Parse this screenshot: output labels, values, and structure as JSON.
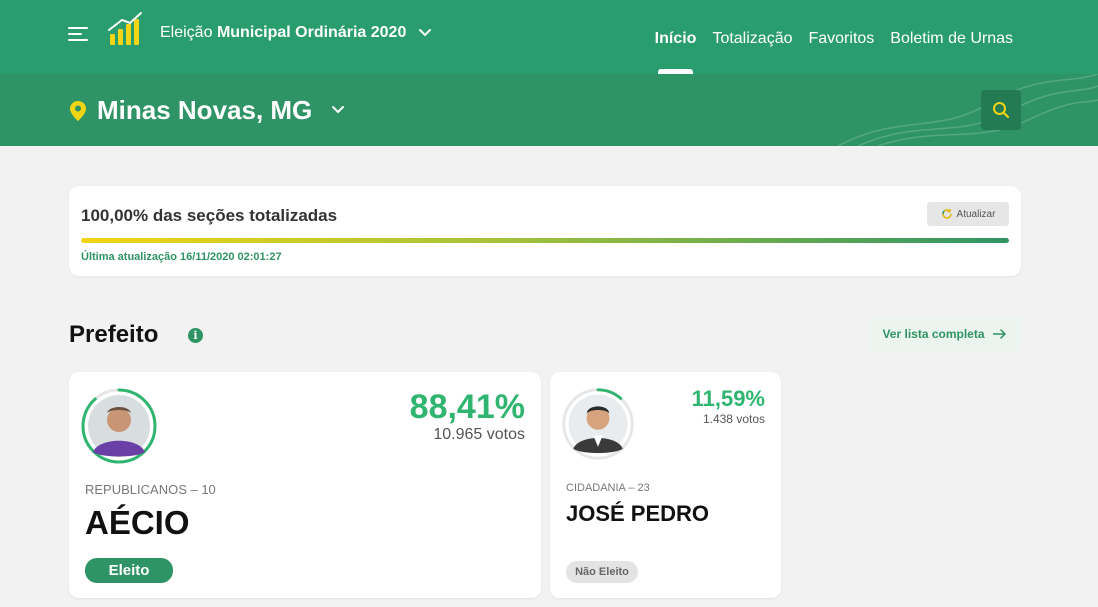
{
  "header": {
    "election_prefix": "Eleição",
    "election_bold": "Municipal Ordinária 2020",
    "nav": [
      "Início",
      "Totalização",
      "Favoritos",
      "Boletim de Urnas"
    ],
    "active_nav": "Início"
  },
  "location": {
    "name": "Minas Novas, MG"
  },
  "progress": {
    "title": "100,00% das seções totalizadas",
    "fraction": 1.0,
    "refresh_label": "Atualizar",
    "updated": "Última atualização 16/11/2020 02:01:27"
  },
  "section": {
    "title": "Prefeito",
    "list_button": "Ver lista completa"
  },
  "candidates": [
    {
      "name": "AÉCIO",
      "party": "REPUBLICANOS – 10",
      "percent": "88,41%",
      "vote_share": 0.8841,
      "votes": "10.965 votos",
      "status": "Eleito"
    },
    {
      "name": "JOSÉ PEDRO",
      "party": "CIDADANIA – 23",
      "percent": "11,59%",
      "vote_share": 0.1159,
      "votes": "1.438 votos",
      "status": "Não Eleito"
    }
  ],
  "colors": {
    "primary": "#2a9d6f",
    "secondary": "#2f9465",
    "accent": "#f2d514",
    "percent": "#2fb56f"
  },
  "icons": {
    "menu": "hamburger-icon",
    "logo": "bar-chart-logo",
    "location": "map-pin-icon",
    "search": "search-icon",
    "refresh": "refresh-icon",
    "info": "info-icon",
    "arrow": "arrow-right-icon"
  }
}
